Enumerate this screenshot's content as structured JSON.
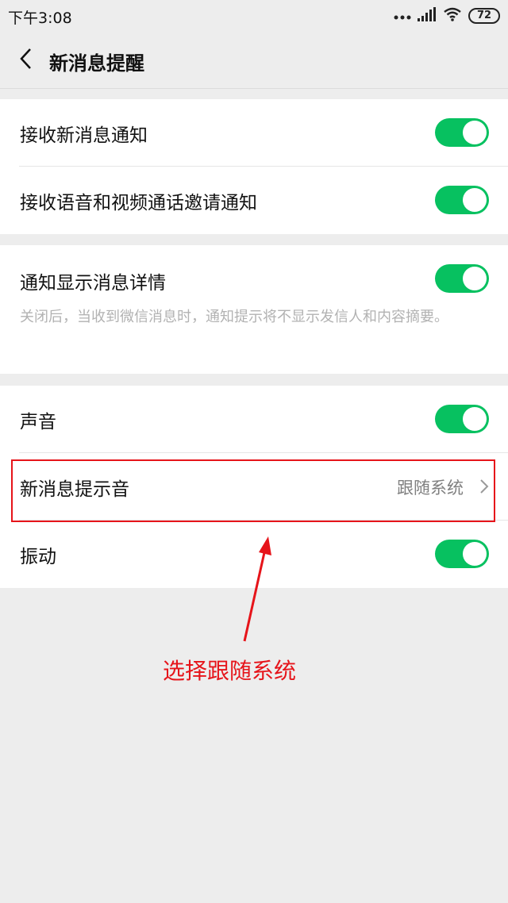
{
  "status_bar": {
    "time": "下午3:08",
    "battery": "72"
  },
  "nav": {
    "title": "新消息提醒"
  },
  "groups": [
    {
      "rows": [
        {
          "label": "接收新消息通知",
          "toggle": "on"
        },
        {
          "label": "接收语音和视频通话邀请通知",
          "toggle": "on"
        }
      ]
    },
    {
      "rows": [
        {
          "label": "通知显示消息详情",
          "toggle": "on",
          "description": "关闭后，当收到微信消息时，通知提示将不显示发信人和内容摘要。"
        }
      ]
    },
    {
      "rows": [
        {
          "label": "声音",
          "toggle": "on"
        },
        {
          "label": "新消息提示音",
          "value": "跟随系统"
        },
        {
          "label": "振动",
          "toggle": "on"
        }
      ]
    }
  ],
  "annotation": {
    "text": "选择跟随系统",
    "color": "#e6141a"
  },
  "colors": {
    "toggle_on": "#07c160",
    "background": "#ededed"
  }
}
